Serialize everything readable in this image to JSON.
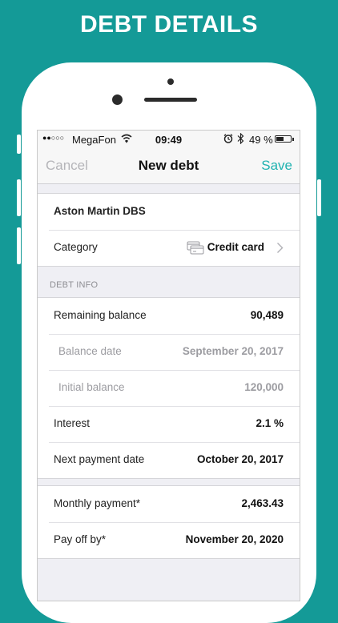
{
  "promo": {
    "title": "DEBT DETAILS"
  },
  "status_bar": {
    "signal": "●●○○○",
    "carrier": "MegaFon",
    "time": "09:49",
    "battery": "49 %"
  },
  "nav": {
    "cancel": "Cancel",
    "title": "New debt",
    "save": "Save"
  },
  "debt": {
    "name": "Aston Martin DBS",
    "category_label": "Category",
    "category_value": "Credit card"
  },
  "section": {
    "debt_info": "DEBT INFO"
  },
  "info": {
    "remaining_label": "Remaining balance",
    "remaining_value": "90,489",
    "balance_date_label": "Balance date",
    "balance_date_value": "September 20, 2017",
    "initial_label": "Initial balance",
    "initial_value": "120,000",
    "interest_label": "Interest",
    "interest_value": "2.1 %",
    "next_payment_label": "Next payment date",
    "next_payment_value": "October 20, 2017"
  },
  "plan": {
    "monthly_label": "Monthly payment*",
    "monthly_value": "2,463.43",
    "payoff_label": "Pay off by*",
    "payoff_value": "November 20, 2020"
  },
  "colors": {
    "background": "#149a97",
    "accent": "#20b2b0",
    "muted": "#9c9ca1"
  },
  "icons": [
    "wifi-icon",
    "alarm-icon",
    "bluetooth-icon",
    "battery-icon",
    "credit-card-icon",
    "chevron-right-icon"
  ]
}
